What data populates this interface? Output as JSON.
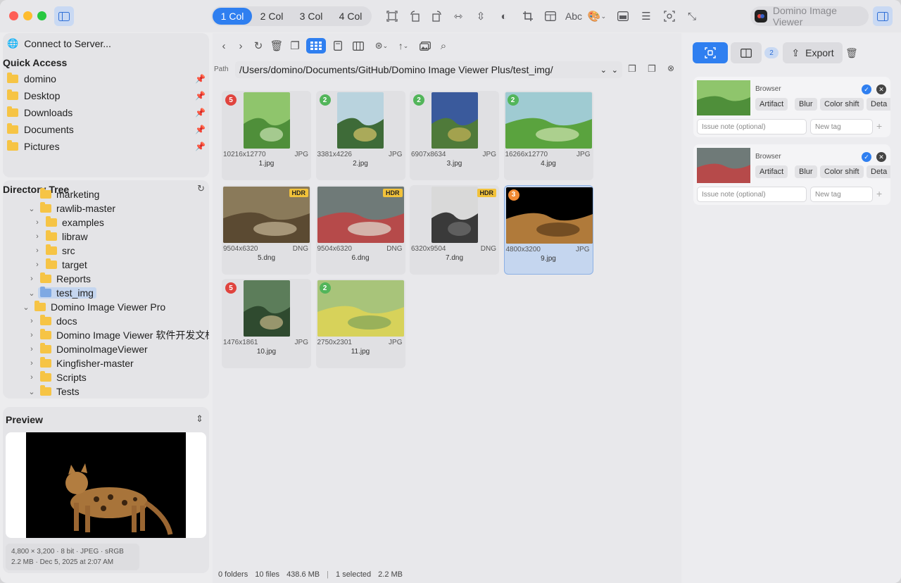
{
  "titlebar": {
    "columns": [
      "1 Col",
      "2 Col",
      "3 Col",
      "4 Col"
    ],
    "active_column": "1 Col",
    "app_name": "Domino Image Viewer",
    "abc_label": "Abc"
  },
  "sidebar": {
    "connect_label": "Connect to Server...",
    "quick_access_title": "Quick Access",
    "quick_access": [
      {
        "label": "domino"
      },
      {
        "label": "Desktop"
      },
      {
        "label": "Downloads"
      },
      {
        "label": "Documents"
      },
      {
        "label": "Pictures"
      }
    ],
    "tree_title": "Directory Tree",
    "tree": [
      {
        "label": "marketing",
        "indent": 0
      },
      {
        "label": "rawlib-master",
        "indent": 0
      },
      {
        "label": "examples",
        "indent": 1
      },
      {
        "label": "libraw",
        "indent": 1
      },
      {
        "label": "src",
        "indent": 1
      },
      {
        "label": "target",
        "indent": 1
      },
      {
        "label": "Reports",
        "indent": 0
      },
      {
        "label": "test_img",
        "indent": 0
      },
      {
        "label": "Domino Image Viewer Pro",
        "indent": -1
      },
      {
        "label": "docs",
        "indent": 0
      },
      {
        "label": "Domino Image Viewer 软件开发文档...",
        "indent": 0
      },
      {
        "label": "DominoImageViewer",
        "indent": 0
      },
      {
        "label": "Kingfisher-master",
        "indent": 0
      },
      {
        "label": "Scripts",
        "indent": 0
      },
      {
        "label": "Tests",
        "indent": 0
      }
    ],
    "preview_title": "Preview",
    "preview_info_1": "4,800 × 3,200 · 8 bit · JPEG · sRGB",
    "preview_info_2": "2.2 MB · Dec 5, 2025 at 2:07 AM"
  },
  "path": {
    "label": "Path",
    "value": "/Users/domino/Documents/GitHub/Domino Image Viewer Plus/test_img/"
  },
  "thumbnails": [
    {
      "name": "1.jpg",
      "dims": "10216x12770",
      "fmt": "JPG",
      "badge": "5",
      "badge_color": "#e0443e",
      "hdr": "",
      "colors": [
        "#8fc56c",
        "#4f8f3a",
        "#cbe3b3"
      ]
    },
    {
      "name": "2.jpg",
      "dims": "3381x4226",
      "fmt": "JPG",
      "badge": "2",
      "badge_color": "#52b55a",
      "hdr": "",
      "colors": [
        "#b9d3de",
        "#3e6b38",
        "#d8c46a"
      ]
    },
    {
      "name": "3.jpg",
      "dims": "6907x8634",
      "fmt": "JPG",
      "badge": "2",
      "badge_color": "#52b55a",
      "hdr": "",
      "colors": [
        "#3a5a9c",
        "#4f7a3a",
        "#c7b457"
      ]
    },
    {
      "name": "4.jpg",
      "dims": "16266x12770",
      "fmt": "JPG",
      "badge": "2",
      "badge_color": "#52b55a",
      "hdr": "",
      "colors": [
        "#9fcbd2",
        "#5aa33e",
        "#cfe2b0"
      ]
    },
    {
      "name": "5.dng",
      "dims": "9504x6320",
      "fmt": "DNG",
      "badge": "",
      "badge_color": "",
      "hdr": "HDR",
      "colors": [
        "#8a7a5a",
        "#5b4a32",
        "#c6b797"
      ]
    },
    {
      "name": "6.dng",
      "dims": "9504x6320",
      "fmt": "DNG",
      "badge": "",
      "badge_color": "",
      "hdr": "HDR",
      "colors": [
        "#6f7a78",
        "#b64a4a",
        "#e1e0d4"
      ]
    },
    {
      "name": "7.dng",
      "dims": "6320x9504",
      "fmt": "DNG",
      "badge": "",
      "badge_color": "",
      "hdr": "HDR",
      "colors": [
        "#d9d9d9",
        "#3a3a3a",
        "#6f6f6f"
      ]
    },
    {
      "name": "9.jpg",
      "dims": "4800x3200",
      "fmt": "JPG",
      "badge": "3",
      "badge_color": "#f08a33",
      "hdr": "",
      "colors": [
        "#000000",
        "#b07a3a",
        "#5a3a1a"
      ]
    },
    {
      "name": "10.jpg",
      "dims": "1476x1861",
      "fmt": "JPG",
      "badge": "5",
      "badge_color": "#e0443e",
      "hdr": "",
      "colors": [
        "#5c7d5a",
        "#2f4a2f",
        "#c4b787"
      ]
    },
    {
      "name": "11.jpg",
      "dims": "2750x2301",
      "fmt": "JPG",
      "badge": "2",
      "badge_color": "#52b55a",
      "hdr": "",
      "colors": [
        "#a8c47a",
        "#d7d25a",
        "#7fa35a"
      ]
    }
  ],
  "status": {
    "folders": "0 folders",
    "files": "10 files",
    "size": "438.6 MB",
    "selected": "1 selected",
    "selected_size": "2.2 MB"
  },
  "right_panel": {
    "count_badge": "2",
    "export_label": "Export",
    "cards": [
      {
        "source": "Browser",
        "tags": [
          "Artifact",
          "Blur",
          "Color shift",
          "Deta"
        ],
        "note_placeholder": "Issue note (optional)",
        "tag_placeholder": "New tag"
      },
      {
        "source": "Browser",
        "tags": [
          "Artifact",
          "Blur",
          "Color shift",
          "Deta"
        ],
        "note_placeholder": "Issue note (optional)",
        "tag_placeholder": "New tag"
      }
    ]
  }
}
